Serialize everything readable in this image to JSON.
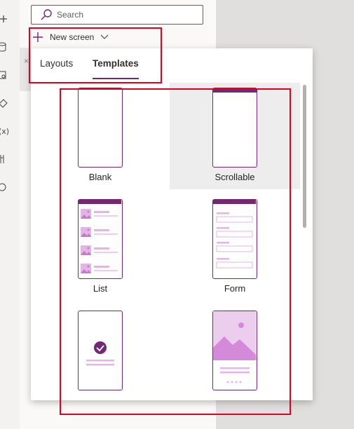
{
  "search": {
    "placeholder": "Search"
  },
  "new_screen": {
    "label": "New screen"
  },
  "tabs": [
    {
      "label": "Layouts",
      "active": false
    },
    {
      "label": "Templates",
      "active": true
    }
  ],
  "templates": [
    {
      "label": "Blank",
      "selected": false
    },
    {
      "label": "Scrollable",
      "selected": true
    },
    {
      "label": "List",
      "selected": false
    },
    {
      "label": "Form",
      "selected": false
    },
    {
      "label": "",
      "selected": false
    },
    {
      "label": "",
      "selected": false
    }
  ],
  "colors": {
    "accent": "#742774",
    "accent_light": "#e3b4e6",
    "annotation": "#e3001b"
  }
}
